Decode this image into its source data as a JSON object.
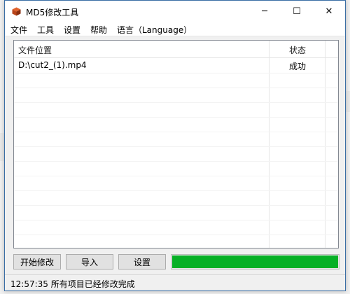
{
  "window": {
    "title": "MD5修改工具",
    "controls": {
      "minimize": "─",
      "maximize": "☐",
      "close": "✕"
    }
  },
  "menu": [
    "文件",
    "工具",
    "设置",
    "帮助",
    "语言（Language）"
  ],
  "table": {
    "columns": [
      "文件位置",
      "状态"
    ],
    "rows": [
      {
        "path": "D:\\cut2_(1).mp4",
        "status": "成功"
      }
    ]
  },
  "buttons": {
    "start": "开始修改",
    "import": "导入",
    "settings": "设置"
  },
  "progress": {
    "value": 1.0,
    "color": "#06b025"
  },
  "status_bar": {
    "text": "12:57:35 所有项目已经修改完成"
  }
}
